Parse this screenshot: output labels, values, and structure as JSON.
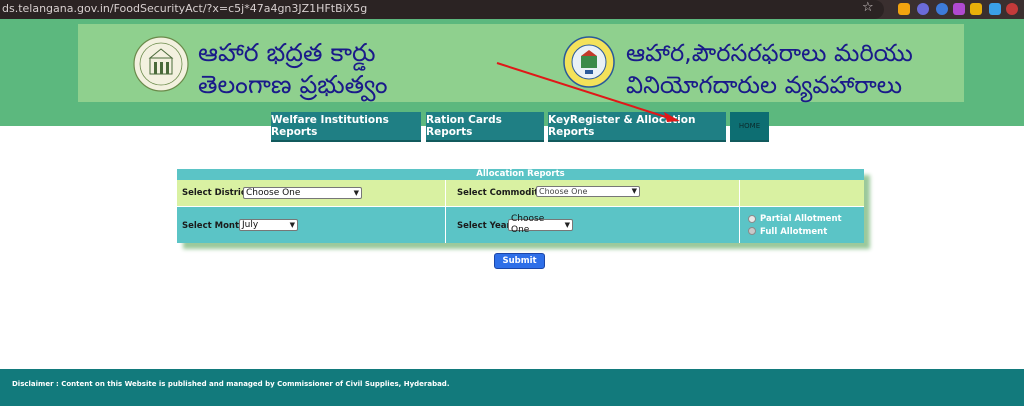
{
  "browser": {
    "url": "ds.telangana.gov.in/FoodSecurityAct/?x=c5j*47a4gn3JZ1HFtBiX5g",
    "extension_colors": [
      "#f2a30f",
      "#6b6bd8",
      "#3d7bd9",
      "#b04ad0",
      "#e8b00a",
      "#3aa0e8",
      "#c43a3a"
    ]
  },
  "header": {
    "left_title_line1": "ఆహార భద్రత కార్డు",
    "left_title_line2": "తెలంగాణ ప్రభుత్వం",
    "right_title_line1": "ఆహార,పౌరసరఫరాలు మరియు",
    "right_title_line2": "వినియోగదారుల వ్యవహారాలు"
  },
  "nav": {
    "welfare": "Welfare Institutions Reports",
    "ration": "Ration Cards Reports",
    "keyregister": "KeyRegister & Allocation Reports",
    "home": "HOME"
  },
  "form": {
    "title": "Allocation Reports",
    "district_label": "Select District:",
    "district_value": "Choose One",
    "commodity_label": "Select Commodity :",
    "commodity_value": "Choose One",
    "month_label": "Select Month:",
    "month_value": "July",
    "year_label": "Select Year :",
    "year_value": "Choose One",
    "required_mark": "*",
    "partial_label": "Partial Allotment",
    "full_label": "Full Allotment",
    "submit_label": "Submit"
  },
  "footer": {
    "disclaimer": "Disclaimer : Content on this Website is published and managed by Commissioner of Civil Supplies, Hyderabad."
  },
  "colors": {
    "header_green": "#5cb87e",
    "nav_teal": "#1f7f84",
    "row_lime": "#d9f1a2",
    "row_cyan": "#5bc4c6",
    "footer_teal": "#127a7c",
    "submit_blue": "#2e6fe8",
    "arrow_red": "#e01818"
  }
}
